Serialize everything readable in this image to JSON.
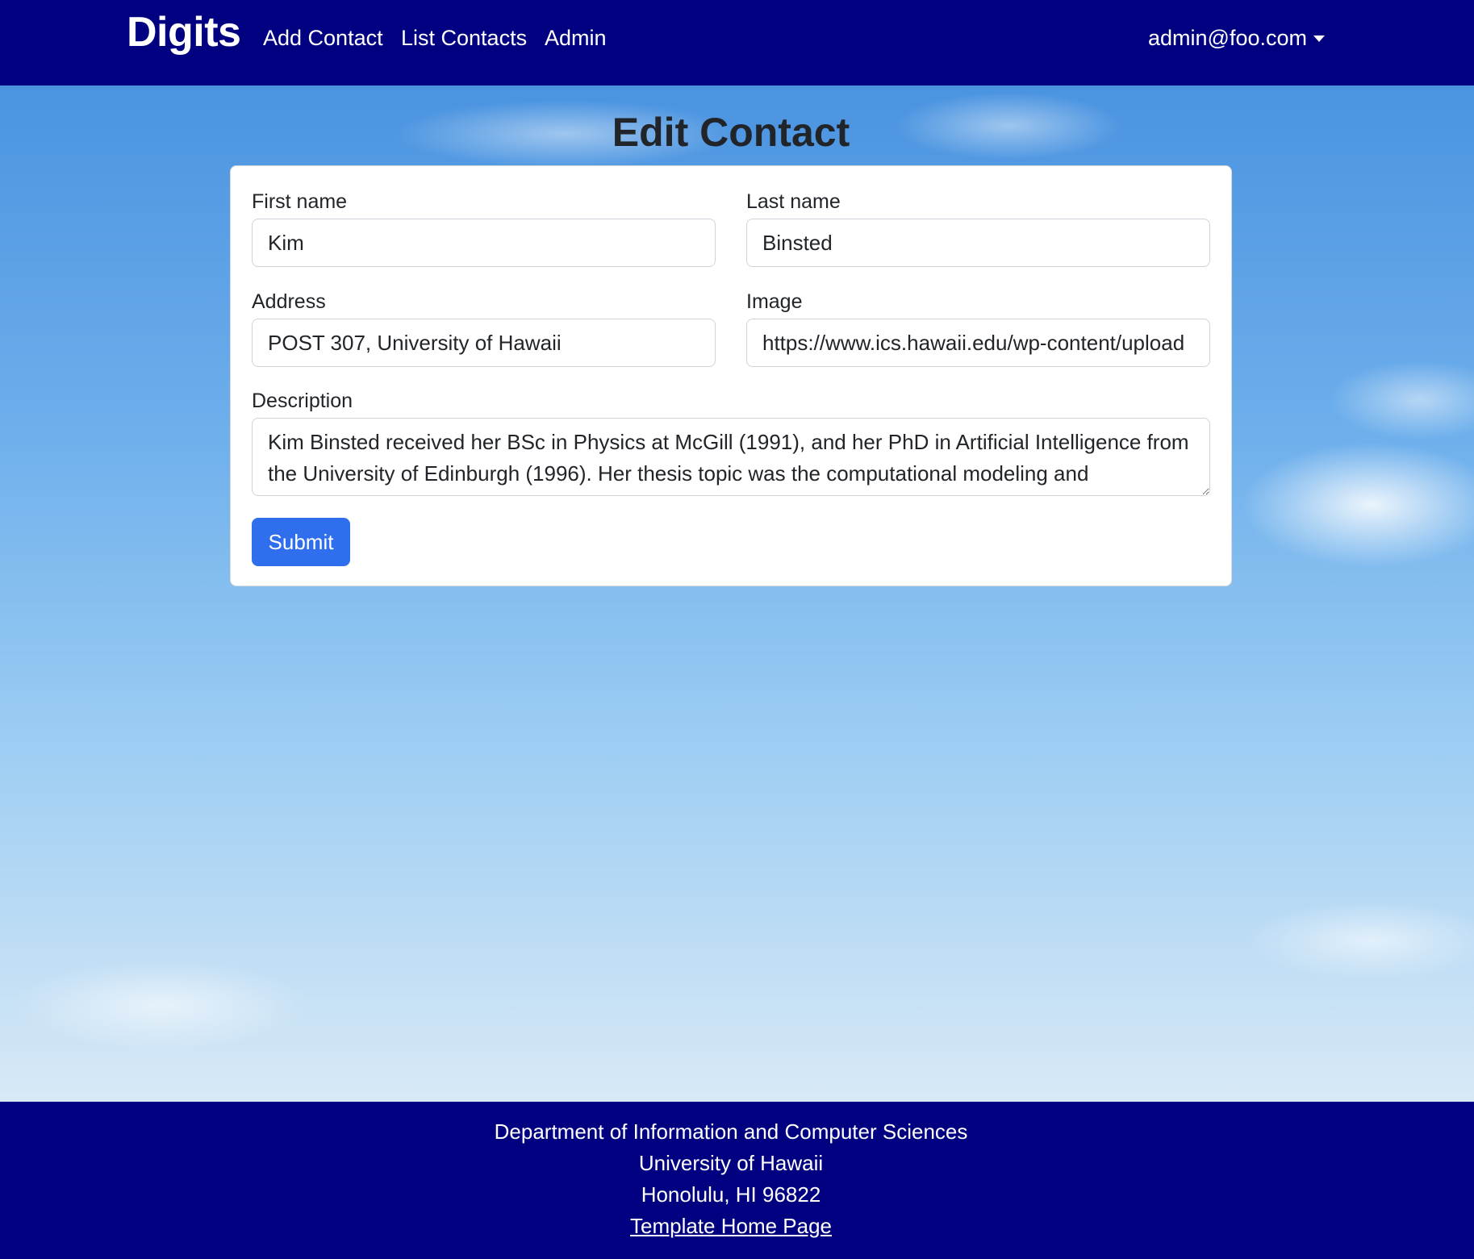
{
  "navbar": {
    "brand": "Digits",
    "links": [
      "Add Contact",
      "List Contacts",
      "Admin"
    ],
    "user": "admin@foo.com",
    "user_icon": "caret-down-icon",
    "background_color": "#000080"
  },
  "page": {
    "title": "Edit Contact"
  },
  "form": {
    "first_name": {
      "label": "First name",
      "value": "Kim"
    },
    "last_name": {
      "label": "Last name",
      "value": "Binsted"
    },
    "address": {
      "label": "Address",
      "value": "POST 307, University of Hawaii"
    },
    "image": {
      "label": "Image",
      "value": "https://www.ics.hawaii.edu/wp-content/upload"
    },
    "description": {
      "label": "Description",
      "value": "Kim Binsted received her BSc in Physics at McGill (1991), and her PhD in Artificial Intelligence from the University of Edinburgh (1996). Her thesis topic was the computational modeling and"
    },
    "submit_label": "Submit",
    "submit_color": "#2f6fed"
  },
  "footer": {
    "lines": [
      "Department of Information and Computer Sciences",
      "University of Hawaii",
      "Honolulu, HI 96822"
    ],
    "link": "Template Home Page",
    "background_color": "#000080"
  }
}
